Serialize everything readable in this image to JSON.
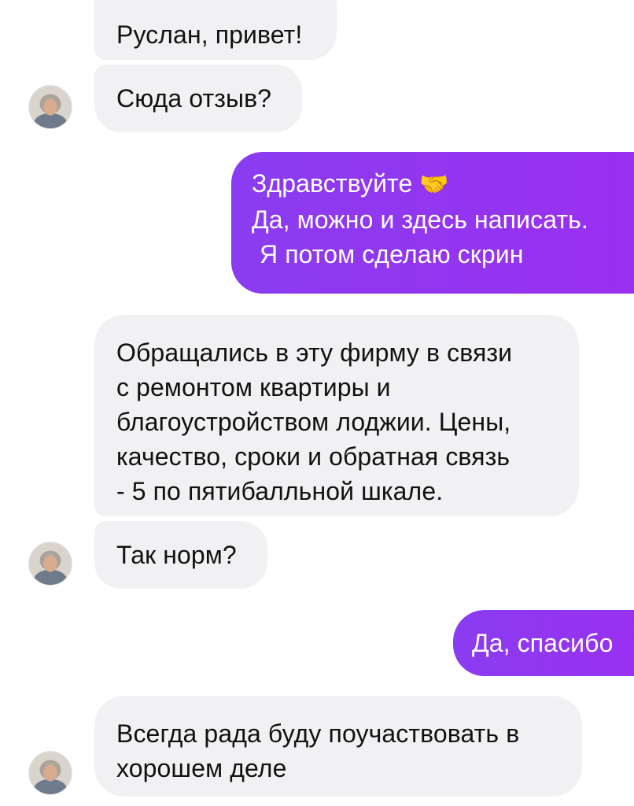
{
  "messages": [
    {
      "id": "m1",
      "direction": "incoming",
      "lines": [
        "Руслан, привет!"
      ]
    },
    {
      "id": "m2",
      "direction": "incoming",
      "lines": [
        "Сюда отзыв?"
      ]
    },
    {
      "id": "m3",
      "direction": "outgoing",
      "lines": [
        "Здравствуйте",
        "Да, можно и здесь написать.",
        "Я потом сделаю скрин"
      ],
      "emoji": "🤝"
    },
    {
      "id": "m4",
      "direction": "incoming",
      "lines": [
        "Обращались в эту фирму в связи",
        "с ремонтом квартиры и",
        "благоустройством лоджии. Цены,",
        "качество, сроки и обратная связь",
        "- 5 по пятибалльной шкале."
      ]
    },
    {
      "id": "m5",
      "direction": "incoming",
      "lines": [
        "Так норм?"
      ]
    },
    {
      "id": "m6",
      "direction": "outgoing",
      "lines": [
        "Да, спасибо"
      ]
    },
    {
      "id": "m7",
      "direction": "incoming",
      "lines": [
        "Всегда рада буду поучаствовать в",
        "хорошем деле"
      ]
    }
  ],
  "colors": {
    "incoming_bubble": "#f1f1f4",
    "outgoing_bubble_start": "#8a3cf0",
    "outgoing_bubble_end": "#9b2ff0",
    "incoming_text": "#111111",
    "outgoing_text": "#ffffff"
  },
  "icons": {
    "avatar": "sender-avatar",
    "handshake": "handshake-emoji"
  }
}
